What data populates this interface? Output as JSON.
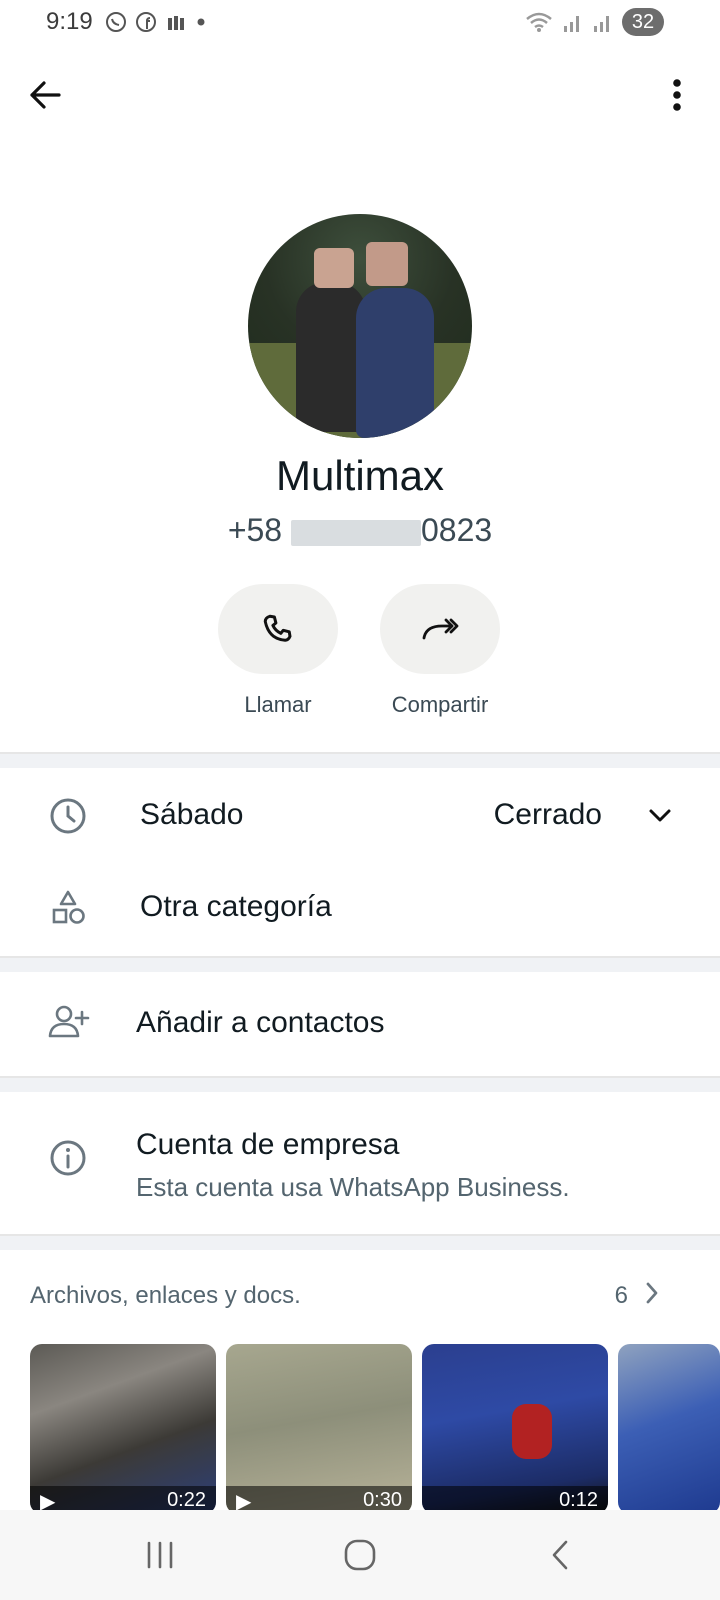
{
  "status_bar": {
    "time": "9:19",
    "battery": "32",
    "left_icons": [
      "whatsapp-icon",
      "facebook-icon",
      "tools-icon",
      "dot-icon"
    ],
    "right_icons": [
      "wifi-icon",
      "signal-icon",
      "signal-icon"
    ]
  },
  "app_bar": {
    "back_icon": "arrow-left-icon",
    "menu_icon": "more-vertical-icon"
  },
  "profile": {
    "name": "Multimax",
    "phone_prefix": "+58",
    "phone_suffix": "0823"
  },
  "actions": [
    {
      "label": "Llamar",
      "icon": "phone-icon"
    },
    {
      "label": "Compartir",
      "icon": "forward-icon"
    }
  ],
  "business_hours": {
    "day": "Sábado",
    "status": "Cerrado",
    "icon": "clock-icon",
    "expand_icon": "chevron-down-icon"
  },
  "category": {
    "label": "Otra categoría",
    "icon": "shapes-icon"
  },
  "add_contact": {
    "label": "Añadir a contactos",
    "icon": "person-add-icon"
  },
  "business_account": {
    "title": "Cuenta de empresa",
    "subtitle": "Esta cuenta usa WhatsApp Business.",
    "icon": "info-icon"
  },
  "media": {
    "title": "Archivos, enlaces y docs.",
    "count": "6",
    "items": [
      {
        "type": "video",
        "duration": "0:22"
      },
      {
        "type": "video",
        "duration": "0:30"
      },
      {
        "type": "image",
        "duration": "0:12"
      },
      {
        "type": "image",
        "duration": ""
      }
    ]
  },
  "nav_bar": {
    "recent_icon": "recent-apps-icon",
    "home_icon": "home-icon",
    "back_icon": "nav-back-icon"
  },
  "colors": {
    "background": "#ffffff",
    "separator": "#f0f2f5",
    "pill": "#f1f1ef",
    "text_primary": "#111b21",
    "text_secondary": "#54656f"
  }
}
